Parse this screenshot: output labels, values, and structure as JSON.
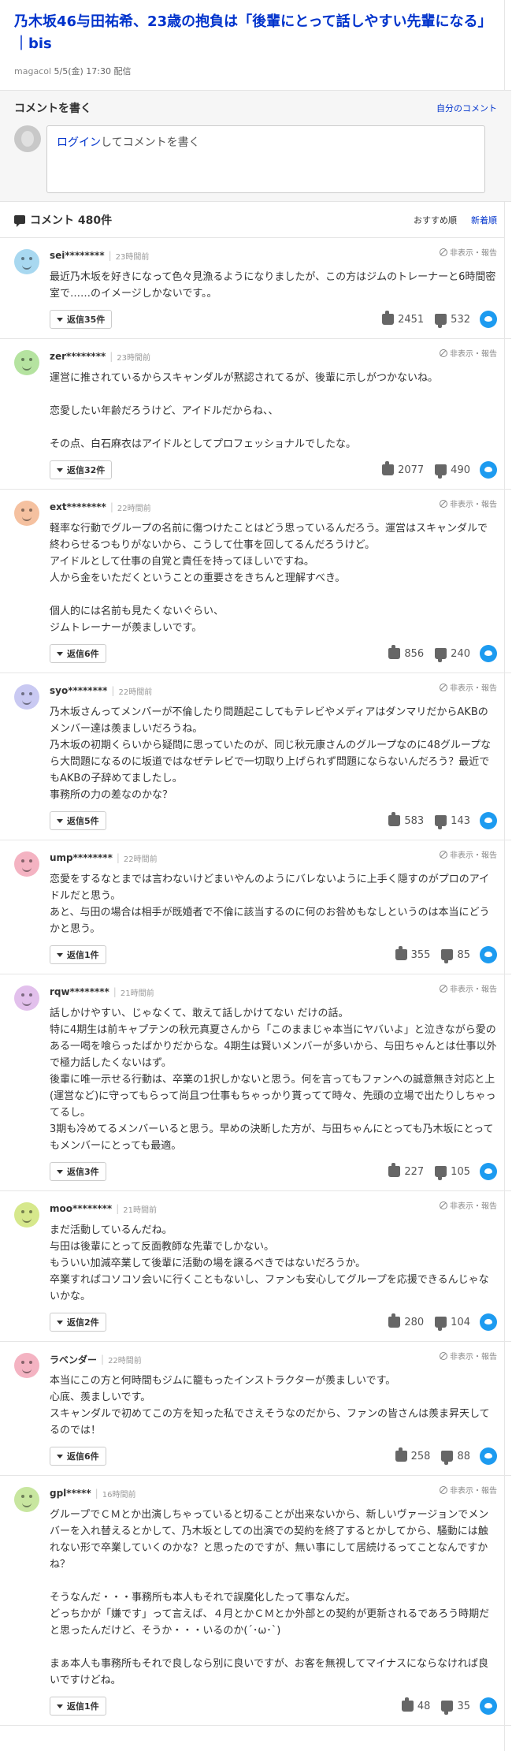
{
  "article": {
    "title": "乃木坂46与田祐希、23歳の抱負は「後輩にとって話しやすい先輩になる」｜bis",
    "source": "magacol",
    "datetime": "5/5(金) 17:30 配信"
  },
  "write": {
    "title": "コメントを書く",
    "my_comments": "自分のコメント",
    "login": "ログイン",
    "prompt": "してコメントを書く"
  },
  "list": {
    "count_label": "コメント 480件",
    "sort_recommend": "おすすめ順",
    "sort_newest": "新着順"
  },
  "labels": {
    "report": "非表示・報告"
  },
  "comments": [
    {
      "user": "sei********",
      "time": "23時間前",
      "avatar_color": "#a8d8f0",
      "text": "最近乃木坂を好きになって色々見漁るようになりましたが、この方はジムのトレーナーと6時間密室で……のイメージしかないです。。",
      "replies": "返信35件",
      "likes": "2451",
      "dislikes": "532"
    },
    {
      "user": "zer********",
      "time": "23時間前",
      "avatar_color": "#b5e3a0",
      "text": "運営に推されているからスキャンダルが黙認されてるが、後輩に示しがつかないね。\n\n恋愛したい年齢だろうけど、アイドルだからね、、\n\nその点、白石麻衣はアイドルとしてプロフェッショナルでしたな。",
      "replies": "返信32件",
      "likes": "2077",
      "dislikes": "490"
    },
    {
      "user": "ext********",
      "time": "22時間前",
      "avatar_color": "#f5c1a0",
      "text": "軽率な行動でグループの名前に傷つけたことはどう思っているんだろう。運営はスキャンダルで終わらせるつもりがないから、こうして仕事を回してるんだろうけど。\nアイドルとして仕事の自覚と責任を持ってほしいですね。\n人から金をいただくということの重要さをきちんと理解すべき。\n\n個人的には名前も見たくないぐらい、\nジムトレーナーが羨ましいです。",
      "replies": "返信6件",
      "likes": "856",
      "dislikes": "240"
    },
    {
      "user": "syo********",
      "time": "22時間前",
      "avatar_color": "#c9c9f2",
      "text": "乃木坂さんってメンバーが不倫したり問題起こしてもテレビやメディアはダンマリだからAKBのメンバー達は羨ましいだろうね。\n乃木坂の初期くらいから疑問に思っていたのが、同じ秋元康さんのグループなのに48グループなら大問題になるのに坂道ではなぜテレビで一切取り上げられず問題にならないんだろう？最近でもAKBの子辞めてましたし。\n事務所の力の差なのかな？",
      "replies": "返信5件",
      "likes": "583",
      "dislikes": "143"
    },
    {
      "user": "ump********",
      "time": "22時間前",
      "avatar_color": "#f4b3c2",
      "text": "恋愛をするなとまでは言わないけどまいやんのようにバレないように上手く隠すのがプロのアイドルだと思う。\nあと、与田の場合は相手が既婚者で不倫に該当するのに何のお咎めもなしというのは本当にどうかと思う。",
      "replies": "返信1件",
      "likes": "355",
      "dislikes": "85"
    },
    {
      "user": "rqw********",
      "time": "21時間前",
      "avatar_color": "#e2c0ec",
      "text": "話しかけやすい、じゃなくて、敢えて話しかけてない だけの話。\n特に4期生は前キャプテンの秋元真夏さんから「このままじゃ本当にヤバいよ」と泣きながら愛のある一喝を喰らったばかりだからな。4期生は賢いメンバーが多いから、与田ちゃんとは仕事以外で極力話したくないはず。\n後輩に唯一示せる行動は、卒業の1択しかないと思う。何を言ってもファンへの誠意無き対応と上(運営など)に守ってもらって尚且つ仕事もちゃっかり貰ってて時々、先頭の立場で出たりしちゃってるし。\n3期も冷めてるメンバーいると思う。早めの決断した方が、与田ちゃんにとっても乃木坂にとってもメンバーにとっても最適。",
      "replies": "返信3件",
      "likes": "227",
      "dislikes": "105"
    },
    {
      "user": "moo********",
      "time": "21時間前",
      "avatar_color": "#d6e88c",
      "text": "まだ活動しているんだね。\n与田は後輩にとって反面教師な先輩でしかない。\nもういい加減卒業して後輩に活動の場を譲るべきではないだろうか。\n卒業すればコソコソ会いに行くこともないし、ファンも安心してグループを応援できるんじゃないかな。",
      "replies": "返信2件",
      "likes": "280",
      "dislikes": "104"
    },
    {
      "user": "ラベンダー",
      "time": "22時間前",
      "avatar_color": "#f4b3c2",
      "text": "本当にこの方と何時間もジムに籠もったインストラクターが羨ましいです。\n心底、羨ましいです。\nスキャンダルで初めてこの方を知った私でさえそうなのだから、ファンの皆さんは羨ま昇天してるのでは！",
      "replies": "返信6件",
      "likes": "258",
      "dislikes": "88"
    },
    {
      "user": "gpl*****",
      "time": "16時間前",
      "avatar_color": "#c8e6a0",
      "text": "グループでＣＭとか出演しちゃっていると切ることが出来ないから、新しいヴァージョンでメンバーを入れ替えるとかして、乃木坂としての出演での契約を終了するとかしてから、騒動には触れない形で卒業していくのかな？と思ったのですが、無い事にして居続けるってことなんですかね？\n\nそうなんだ・・・事務所も本人もそれで誤魔化したって事なんだ。\nどっちかが「嫌です」って言えば、４月とかＣＭとか外部との契約が更新されるであろう時期だと思ったんだけど、そうか・・・いるのか(´･ω･`)\n\nまぁ本人も事務所もそれで良しなら別に良いですが、お客を無視してマイナスにならなければ良いですけどね。",
      "replies": "返信1件",
      "likes": "48",
      "dislikes": "35"
    }
  ]
}
